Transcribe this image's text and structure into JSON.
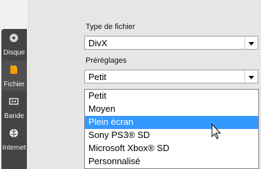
{
  "sidebar": {
    "items": [
      {
        "label": "Disque",
        "icon": "disc-icon",
        "selected": false
      },
      {
        "label": "Fichier",
        "icon": "file-icon",
        "selected": true
      },
      {
        "label": "Bande",
        "icon": "tape-icon",
        "selected": false
      },
      {
        "label": "Internet",
        "icon": "globe-icon",
        "selected": false
      }
    ]
  },
  "form": {
    "file_type_label": "Type de fichier",
    "file_type_value": "DivX",
    "presets_label": "Préréglages",
    "presets_value": "Petit"
  },
  "dropdown": {
    "options": [
      "Petit",
      "Moyen",
      "Plein écran",
      "Sony PS3® SD",
      "Microsoft Xbox® SD",
      "Personnalisé"
    ],
    "highlighted_index": 2
  },
  "colors": {
    "highlight": "#3399ff",
    "sidebar_bg": "#444444"
  }
}
